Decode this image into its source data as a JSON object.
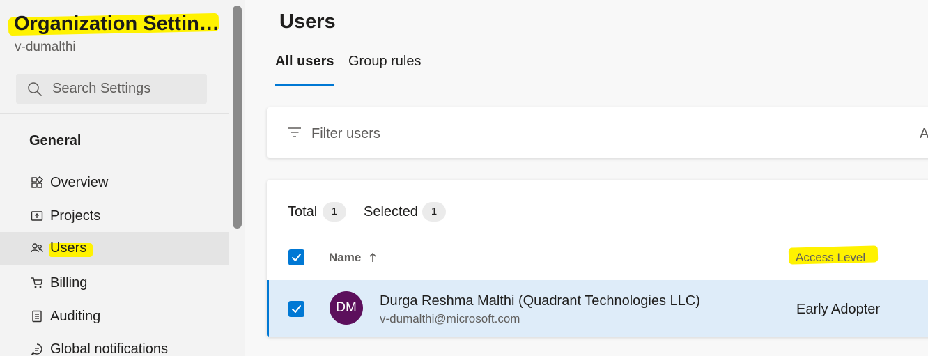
{
  "sidebar": {
    "title": "Organization Settin…",
    "subtitle": "v-dumalthi",
    "search": {
      "placeholder": "Search Settings",
      "icon": "search-icon"
    },
    "section_heading": "General",
    "items": [
      {
        "label": "Overview",
        "icon": "overview-icon",
        "selected": false
      },
      {
        "label": "Projects",
        "icon": "projects-icon",
        "selected": false
      },
      {
        "label": "Users",
        "icon": "users-icon",
        "selected": true
      },
      {
        "label": "Billing",
        "icon": "cart-icon",
        "selected": false
      },
      {
        "label": "Auditing",
        "icon": "auditing-icon",
        "selected": false
      },
      {
        "label": "Global notifications",
        "icon": "notifications-icon",
        "selected": false
      }
    ]
  },
  "main": {
    "title": "Users",
    "tabs": [
      {
        "label": "All users",
        "active": true
      },
      {
        "label": "Group rules",
        "active": false
      }
    ],
    "filter": {
      "placeholder": "Filter users",
      "trailing": "A",
      "icon": "filter-icon"
    },
    "summary": {
      "total_label": "Total",
      "total_count": "1",
      "selected_label": "Selected",
      "selected_count": "1"
    },
    "table": {
      "columns": [
        {
          "label": "Name",
          "sort": "ascending"
        },
        {
          "label": "Access Level"
        }
      ],
      "rows": [
        {
          "initials": "DM",
          "name": "Durga Reshma Malthi (Quadrant Technologies LLC)",
          "email": "v-dumalthi@microsoft.com",
          "access_level": "Early Adopter",
          "selected": true
        }
      ]
    }
  },
  "colors": {
    "accent": "#0078d4",
    "highlight": "#fff200",
    "avatar": "#5c0f5c",
    "row_selected": "#deecf9",
    "sidebar_bg": "#f3f3f3"
  }
}
